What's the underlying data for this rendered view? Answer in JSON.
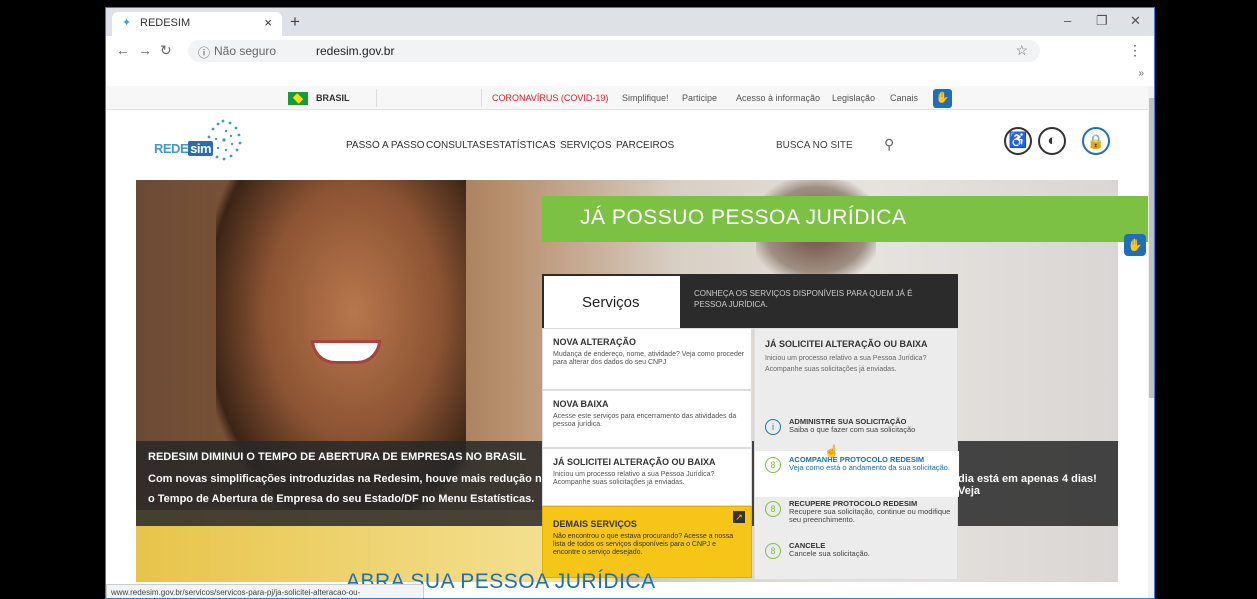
{
  "browser": {
    "tab_title": "REDESIM",
    "tab_close": "×",
    "new_tab": "+",
    "min": "–",
    "max": "❐",
    "close": "✕",
    "not_secure": "Não seguro",
    "url": "redesim.gov.br",
    "status_url": "www.redesim.gov.br/servicos/servicos-para-pj/ja-solicitei-alteracao-ou-baixa/acompanhe"
  },
  "govbar": {
    "brasil": "BRASIL",
    "links": [
      "CORONAVÍRUS (COVID-19)",
      "Simplifique!",
      "Participe",
      "Acesso à informação",
      "Legislação",
      "Canais"
    ]
  },
  "header": {
    "logo": "REDESIM",
    "menu": [
      "PASSO A PASSO",
      "CONSULTAS",
      "ESTATÍSTICAS",
      "SERVIÇOS",
      "PARCEIROS"
    ],
    "search_placeholder": "BUSCA NO SITE"
  },
  "news": {
    "heading": "REDESIM DIMINUI O TEMPO DE ABERTURA DE EMPRESAS NO BRASIL",
    "line1": "Com novas simplificações introduzidas na Redesim, houve mais redução no tempo d",
    "line2": "o Tempo de Abertura de Empresa do seu Estado/DF no Menu Estatísticas.",
    "line3": "dia está em apenas 4 dias! Veja"
  },
  "banner": {
    "title": "JÁ POSSUO PESSOA JURÍDICA"
  },
  "services": {
    "tab": "Serviços",
    "desc": "CONHEÇA OS SERVIÇOS DISPONÍVEIS PARA QUEM JÁ É PESSOA JURÍDICA.",
    "cards": [
      {
        "title": "NOVA ALTERAÇÃO",
        "desc": "Mudança de endereço, nome, atividade? Veja como proceder para alterar dos dados do seu CNPJ"
      },
      {
        "title": "NOVA BAIXA",
        "desc": "Acesse este serviços para encerramento das atividades da pessoa jurídica."
      },
      {
        "title": "JÁ SOLICITEI ALTERAÇÃO OU BAIXA",
        "desc": "Iniciou um processo relativo a sua Pessoa Jurídica? Acompanhe suas solicitações já enviadas."
      },
      {
        "title": "DEMAIS SERVIÇOS",
        "desc": "Não encontrou o que estava procurando? Acesse a nossa lista de todos os serviços disponíveis para o CNPJ e encontre o serviço desejado."
      }
    ],
    "right": {
      "title": "JÁ SOLICITEI ALTERAÇÃO OU BAIXA",
      "desc": "Iniciou um processo relativo a sua Pessoa Jurídica? Acompanhe suas solicitações já enviadas.",
      "items": [
        {
          "title": "ADMINISTRE SUA SOLICITAÇÃO",
          "desc": "Saiba o que fazer com sua solicitação"
        },
        {
          "title": "ACOMPANHE PROTOCOLO REDESIM",
          "desc": "Veja como está o andamento da sua solicitação."
        },
        {
          "title": "RECUPERE PROTOCOLO REDESIM",
          "desc": "Recupere sua solicitação, continue ou modifique seu preenchimento."
        },
        {
          "title": "CANCELE",
          "desc": "Cancele sua solicitação."
        }
      ]
    }
  },
  "bottom": {
    "title": "ABRA SUA PESSOA JURÍDICA"
  },
  "colors": {
    "green": "#7cc143",
    "yellow": "#f5c518",
    "blue": "#1d6fb8",
    "covid_red": "#d9262c"
  }
}
